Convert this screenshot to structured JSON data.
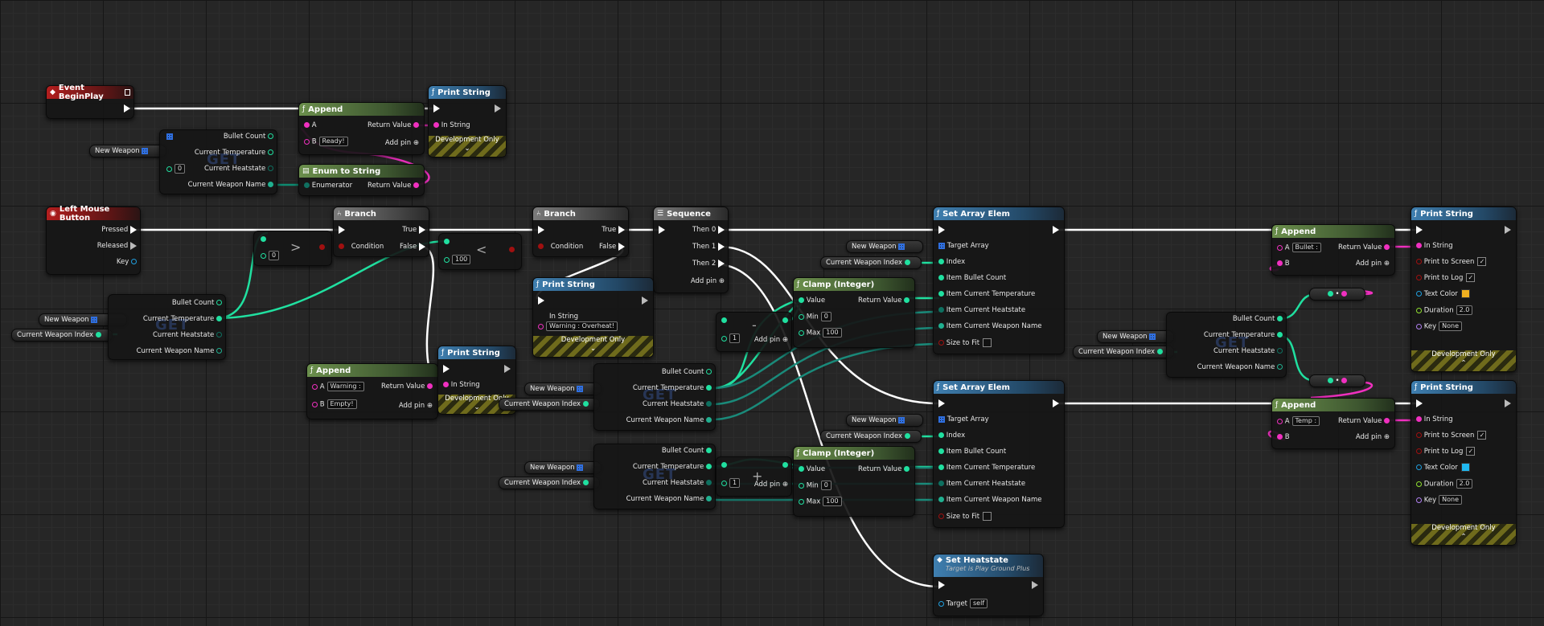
{
  "colors": {
    "exec": "#ffffff",
    "string": "#f030c0",
    "int": "#20e0a0",
    "struct": "#1a8a7a",
    "object": "#20a0e0",
    "bool": "#a01010",
    "float": "#90e030",
    "enum": "#107060",
    "text_color_1": "#f0b020",
    "text_color_2": "#20b8f0"
  },
  "event_beginplay": {
    "title": "Event BeginPlay"
  },
  "lmb": {
    "title": "Left Mouse Button",
    "pressed": "Pressed",
    "released": "Released",
    "key": "Key"
  },
  "var_new_weapon": "New Weapon",
  "var_cwi": "Current Weapon Index",
  "get_label": "GET",
  "get_fields": {
    "bullet": "Bullet Count",
    "temp": "Current Temperature",
    "heat": "Current Heatstate",
    "name": "Current Weapon Name"
  },
  "get1_index": "0",
  "append1": {
    "title": "Append",
    "a": "A",
    "b": "B",
    "b_val": "Ready!",
    "ret": "Return Value",
    "addpin": "Add pin"
  },
  "enum_to_string": {
    "title": "Enum to String",
    "in": "Enumerator",
    "ret": "Return Value"
  },
  "print": {
    "title": "Print String",
    "in": "In String",
    "dev": "Development Only",
    "screen": "Print to Screen",
    "log": "Print to Log",
    "color": "Text Color",
    "dur": "Duration",
    "key": "Key",
    "dur_val": "2.0",
    "key_val": "None"
  },
  "branch": {
    "title": "Branch",
    "cond": "Condition",
    "t": "True",
    "f": "False"
  },
  "gt": {
    "op": ">",
    "b": "0"
  },
  "lt": {
    "op": "<",
    "b": "100"
  },
  "sequence": {
    "title": "Sequence",
    "then0": "Then 0",
    "then1": "Then 1",
    "then2": "Then 2",
    "addpin": "Add pin"
  },
  "print_overheat": "Warning : Overheat!",
  "append_warn": {
    "a_val": "Warning :",
    "b_val": "Empty!"
  },
  "minus": {
    "op": "-",
    "b": "1",
    "addpin": "Add pin"
  },
  "plus": {
    "op": "+",
    "b": "1",
    "addpin": "Add pin"
  },
  "clamp": {
    "title": "Clamp (Integer)",
    "value": "Value",
    "min": "Min",
    "max": "Max",
    "ret": "Return Value",
    "min_val": "0",
    "max_val": "100"
  },
  "set_array": {
    "title": "Set Array Elem",
    "target": "Target Array",
    "index": "Index",
    "bullet": "Item Bullet Count",
    "temp": "Item Current Temperature",
    "heat": "Item Current Heatstate",
    "name": "Item Current Weapon Name",
    "size": "Size to Fit"
  },
  "set_heat": {
    "title": "Set Heatstate",
    "subtitle": "Target is Play Ground Plus",
    "target": "Target",
    "target_val": "self"
  },
  "append_bullet": {
    "a_val": "Bullet :"
  },
  "append_temp": {
    "a_val": "Temp :"
  },
  "dot": "•"
}
